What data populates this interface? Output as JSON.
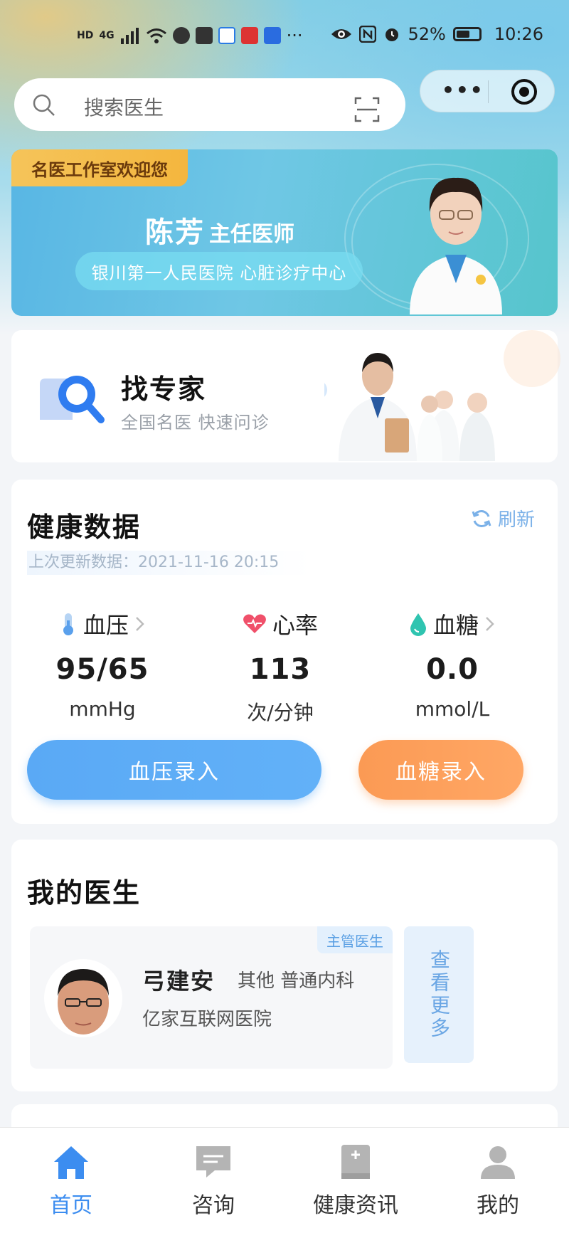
{
  "status_bar": {
    "hd": "HD",
    "net": "4G",
    "dots": "···",
    "battery_pct": "52%",
    "time": "10:26"
  },
  "search": {
    "placeholder": "搜索医生"
  },
  "capsule": {
    "more": "•••"
  },
  "banner": {
    "tag": "名医工作室欢迎您",
    "name": "陈芳",
    "title": "主任医师",
    "hospital": "银川第一人民医院 心脏诊疗中心"
  },
  "find_expert": {
    "title": "找专家",
    "subtitle": "全国名医 快速问诊"
  },
  "health": {
    "title": "健康数据",
    "refresh": "刷新",
    "updated": "上次更新数据：2021-11-16 20:15",
    "metrics": [
      {
        "label": "血压",
        "value": "95/65",
        "unit": "mmHg"
      },
      {
        "label": "心率",
        "value": "113",
        "unit": "次/分钟"
      },
      {
        "label": "血糖",
        "value": "0.0",
        "unit": "mmol/L"
      }
    ],
    "btn_bp": "血压录入",
    "btn_bs": "血糖录入"
  },
  "my_doctor": {
    "title": "我的医生",
    "tag": "主管医生",
    "name": "弓建安",
    "dept": "其他 普通内科",
    "hospital": "亿家互联网医院",
    "see_more": "查看更多"
  },
  "tabbar": {
    "home": "首页",
    "consult": "咨询",
    "news": "健康资讯",
    "mine": "我的"
  },
  "colors": {
    "accent": "#3c8df0",
    "orange": "#fb9a54",
    "blue_btn": "#5aa9f5"
  }
}
